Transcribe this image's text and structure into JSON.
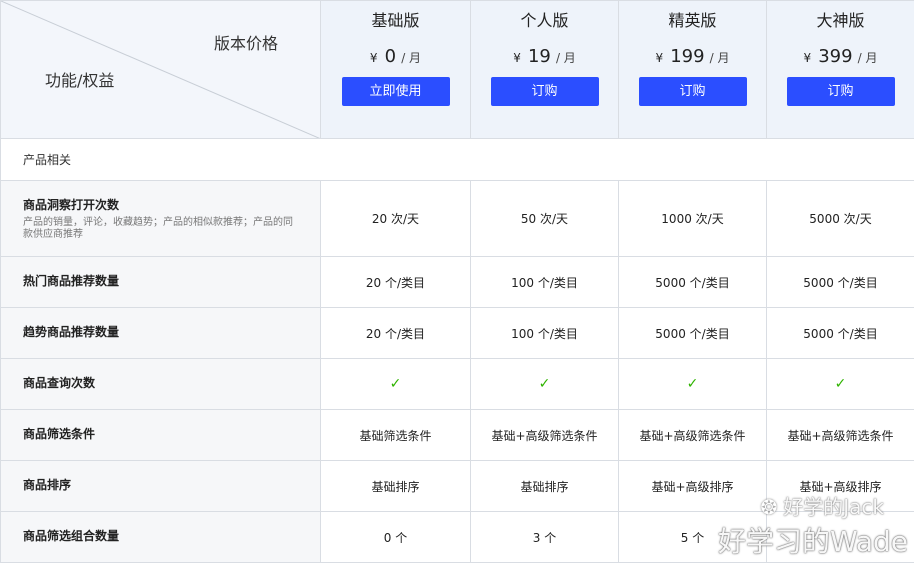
{
  "corner": {
    "price_label": "版本价格",
    "feature_label": "功能/权益"
  },
  "plans": [
    {
      "name": "基础版",
      "currency": "¥",
      "amount": "0",
      "period": "/ 月",
      "button": "立即使用"
    },
    {
      "name": "个人版",
      "currency": "¥",
      "amount": "19",
      "period": "/ 月",
      "button": "订购"
    },
    {
      "name": "精英版",
      "currency": "¥",
      "amount": "199",
      "period": "/ 月",
      "button": "订购"
    },
    {
      "name": "大神版",
      "currency": "¥",
      "amount": "399",
      "period": "/ 月",
      "button": "订购"
    }
  ],
  "section_title": "产品相关",
  "features": [
    {
      "name": "商品洞察打开次数",
      "desc": "产品的销量，评论，收藏趋势；产品的相似款推荐；产品的同款供应商推荐",
      "values": [
        "20 次/天",
        "50 次/天",
        "1000 次/天",
        "5000 次/天"
      ]
    },
    {
      "name": "热门商品推荐数量",
      "values": [
        "20 个/类目",
        "100 个/类目",
        "5000 个/类目",
        "5000 个/类目"
      ]
    },
    {
      "name": "趋势商品推荐数量",
      "values": [
        "20 个/类目",
        "100 个/类目",
        "5000 个/类目",
        "5000 个/类目"
      ]
    },
    {
      "name": "商品查询次数",
      "values": [
        "✓",
        "✓",
        "✓",
        "✓"
      ]
    },
    {
      "name": "商品筛选条件",
      "values": [
        "基础筛选条件",
        "基础+高级筛选条件",
        "基础+高级筛选条件",
        "基础+高级筛选条件"
      ]
    },
    {
      "name": "商品排序",
      "values": [
        "基础排序",
        "基础排序",
        "基础+高级排序",
        "基础+高级排序"
      ]
    },
    {
      "name": "商品筛选组合数量",
      "values": [
        "0 个",
        "3 个",
        "5 个",
        ""
      ]
    }
  ],
  "watermark": {
    "line1": "好学的Jack",
    "line2": "好学习的Wade",
    "icon": "wechat-icon"
  },
  "colors": {
    "button": "#2b4eff",
    "header_bg": "#eef3fa",
    "check": "#2fb400",
    "label_bg": "#f6f7f9"
  }
}
